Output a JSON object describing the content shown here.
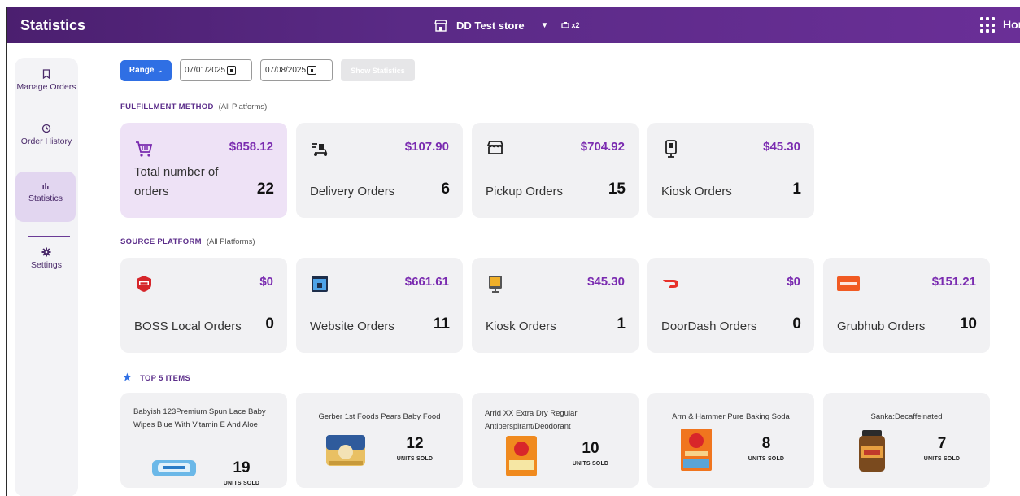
{
  "header": {
    "title": "Statistics",
    "store_name": "DD Test store",
    "store_badge": "x2",
    "home_label": "Hor"
  },
  "sidebar": {
    "items": [
      {
        "label": "Manage Orders",
        "icon": "bookmark-icon"
      },
      {
        "label": "Order History",
        "icon": "history-icon"
      },
      {
        "label": "Statistics",
        "icon": "bar-chart-icon"
      },
      {
        "label": "Settings",
        "icon": "gear-icon"
      }
    ]
  },
  "filters": {
    "range_label": "Range",
    "start_date": "07/01/2025",
    "end_date": "07/08/2025",
    "show_label": "Show Statistics"
  },
  "fulfillment": {
    "title": "FULFILLMENT METHOD",
    "subtitle": "(All Platforms)",
    "cards": [
      {
        "label": "Total number of orders",
        "amount": "$858.12",
        "count": "22",
        "icon": "shopping-cart-icon"
      },
      {
        "label": "Delivery Orders",
        "amount": "$107.90",
        "count": "6",
        "icon": "delivery-scooter-icon"
      },
      {
        "label": "Pickup Orders",
        "amount": "$704.92",
        "count": "15",
        "icon": "store-icon"
      },
      {
        "label": "Kiosk Orders",
        "amount": "$45.30",
        "count": "1",
        "icon": "kiosk-icon"
      }
    ]
  },
  "source": {
    "title": "SOURCE PLATFORM",
    "subtitle": "(All Platforms)",
    "cards": [
      {
        "label": "BOSS Local Orders",
        "amount": "$0",
        "count": "0",
        "icon": "boss-logo-icon"
      },
      {
        "label": "Website Orders",
        "amount": "$661.61",
        "count": "11",
        "icon": "website-icon"
      },
      {
        "label": "Kiosk Orders",
        "amount": "$45.30",
        "count": "1",
        "icon": "kiosk-screen-icon"
      },
      {
        "label": "DoorDash Orders",
        "amount": "$0",
        "count": "0",
        "icon": "doordash-logo-icon"
      },
      {
        "label": "Grubhub Orders",
        "amount": "$151.21",
        "count": "10",
        "icon": "grubhub-logo-icon"
      }
    ]
  },
  "top_items": {
    "title": "TOP 5 ITEMS",
    "units_label": "UNITS SOLD",
    "items": [
      {
        "name": "Babyish 123Premium Spun Lace Baby Wipes Blue With Vitamin E And Aloe",
        "units": "19"
      },
      {
        "name": "Gerber 1st Foods Pears Baby Food",
        "units": "12"
      },
      {
        "name": "Arrid XX Extra Dry Regular Antiperspirant/Deodorant",
        "units": "10"
      },
      {
        "name": "Arm & Hammer Pure Baking Soda",
        "units": "8"
      },
      {
        "name": "Sanka:Decaffeinated",
        "units": "7"
      }
    ]
  },
  "colors": {
    "header": "#5a2a86",
    "accent": "#7a2bb0",
    "primary_button": "#2f6fe4"
  }
}
